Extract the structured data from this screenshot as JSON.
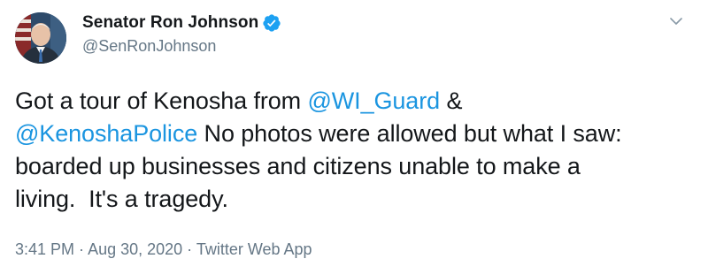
{
  "author": {
    "display_name": "Senator Ron Johnson",
    "handle": "@SenRonJohnson",
    "verified": true,
    "avatar_icon": "profile-photo"
  },
  "tweet": {
    "segments": [
      {
        "text": "Got a tour of Kenosha from ",
        "type": "plain"
      },
      {
        "text": "@WI_Guard",
        "type": "mention"
      },
      {
        "text": " &\n",
        "type": "plain"
      },
      {
        "text": "@KenoshaPolice",
        "type": "mention"
      },
      {
        "text": " No photos were allowed but what I saw:\nboarded up businesses and citizens unable to make a\nliving.  It's a tragedy.",
        "type": "plain"
      }
    ]
  },
  "meta": {
    "time": "3:41 PM",
    "separator": " · ",
    "date": "Aug 30, 2020",
    "source": "Twitter Web App"
  },
  "colors": {
    "mention": "#1b95e0",
    "verified": "#1da1f2",
    "muted": "#657786",
    "text": "#14171a"
  },
  "icons": {
    "menu": "chevron-down-icon",
    "verified": "verified-badge-icon"
  }
}
